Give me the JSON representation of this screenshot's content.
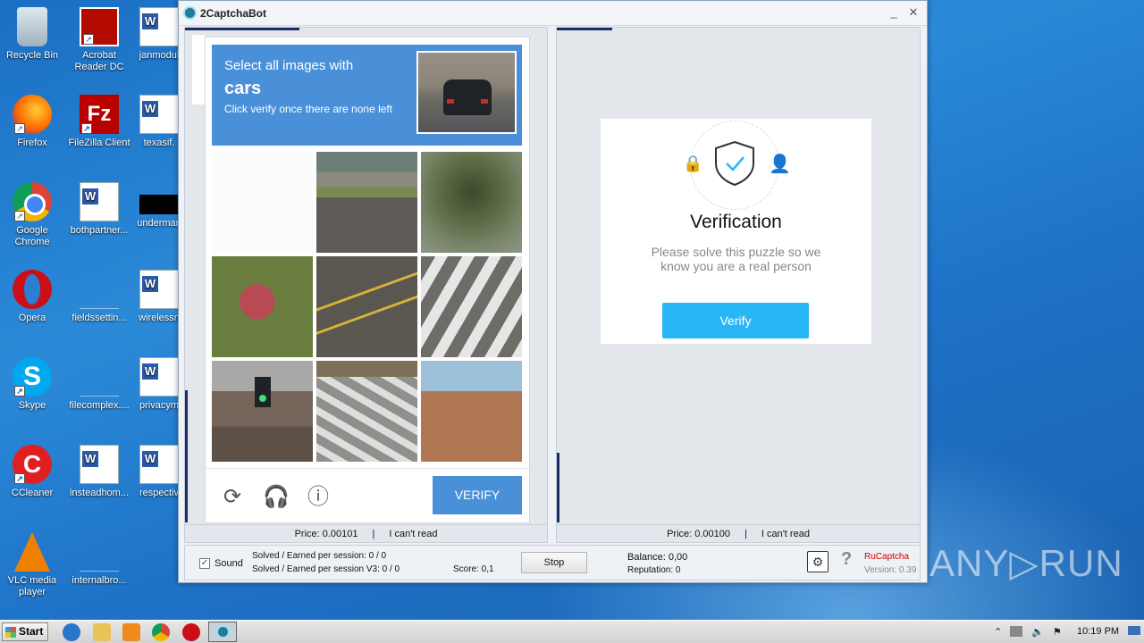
{
  "desktop": {
    "icons_col1": [
      "Recycle Bin",
      "Firefox",
      "Google Chrome",
      "Opera",
      "Skype",
      "CCleaner",
      "VLC media player"
    ],
    "icons_col2": [
      "Acrobat Reader DC",
      "FileZilla Client",
      "bothpartner...",
      "fieldssettin...",
      "filecomplex....",
      "insteadhom...",
      "internalbro..."
    ],
    "icons_col3": [
      "janmodul",
      "texasif.",
      "underman",
      "wirelessn",
      "privacym",
      "respectiv",
      ""
    ]
  },
  "window": {
    "title": "2CaptchaBot",
    "minimize": "_",
    "close": "✕"
  },
  "captcha": {
    "line1": "Select all images with",
    "keyword": "cars",
    "line3": "Click verify once there are none left",
    "verify_label": "VERIFY",
    "reload_icon": "⟳",
    "audio_icon": "🎧",
    "info_icon": "ⓘ"
  },
  "left_footer": {
    "price": "Price: 0.00101",
    "sep": "|",
    "cant_read": "I can't read"
  },
  "right_footer": {
    "price": "Price: 0.00100",
    "sep": "|",
    "cant_read": "I can't read"
  },
  "verification": {
    "title": "Verification",
    "desc": "Please solve this puzzle so we know you are a real person",
    "button": "Verify",
    "lock_icon": "🔒",
    "user_icon": "👤"
  },
  "status": {
    "sound_check": "✓",
    "sound_label": "Sound",
    "solved": "Solved / Earned per session: 0 / 0",
    "solved_v3": "Solved / Earned per session V3: 0 / 0",
    "score": "Score: 0,1",
    "stop": "Stop",
    "balance": "Balance:  0,00",
    "reputation": "Reputation: 0",
    "service": "RuCaptcha",
    "version": "Version: 0.39",
    "help": "?",
    "settings": "⚙"
  },
  "watermark": "ANY▷RUN",
  "taskbar": {
    "start": "Start",
    "clock": "10:19 PM",
    "tray_up": "⌃"
  },
  "colors": {
    "captcha_blue": "#4a90d9",
    "verify_blue": "#29b6f6",
    "service_red": "#cc0000"
  }
}
